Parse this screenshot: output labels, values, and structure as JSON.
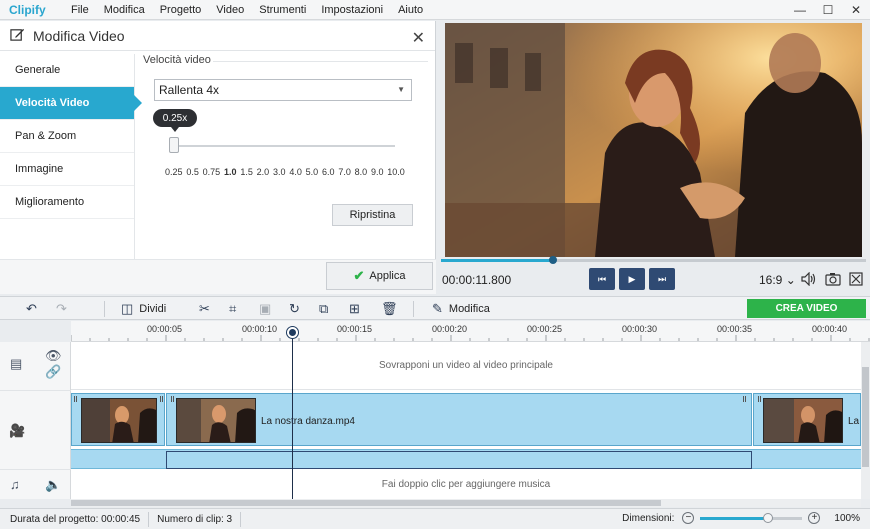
{
  "app": {
    "logo": "Clipify",
    "menu": [
      "File",
      "Modifica",
      "Progetto",
      "Video",
      "Strumenti",
      "Impostazioni",
      "Aiuto"
    ],
    "window_controls": {
      "minimize": "—",
      "maximize": "☐",
      "close": "✕"
    }
  },
  "edit_panel": {
    "title": "Modifica Video",
    "close": "✕",
    "tabs": [
      {
        "label": "Generale",
        "active": false
      },
      {
        "label": "Velocità Video",
        "active": true
      },
      {
        "label": "Pan & Zoom",
        "active": false
      },
      {
        "label": "Immagine",
        "active": false
      },
      {
        "label": "Miglioramento",
        "active": false
      }
    ],
    "speed": {
      "section_label": "Velocità video",
      "selected": "Rallenta 4x",
      "tooltip": "0.25x",
      "ticks": [
        "0.25",
        "0.5",
        "0.75",
        "1.0",
        "1.5",
        "2.0",
        "3.0",
        "4.0",
        "5.0",
        "6.0",
        "7.0",
        "8.0",
        "9.0",
        "10.0"
      ],
      "reset_label": "Ripristina"
    },
    "apply_label": "Applica"
  },
  "preview": {
    "timecode": "00:00:11.800",
    "progress_fraction": 0.26,
    "aspect_ratio": "16:9",
    "aspect_caret": "⌄"
  },
  "toolbar": {
    "split_label": "Dividi",
    "edit_label": "Modifica",
    "create_label": "CREA VIDEO"
  },
  "timeline": {
    "ruler_labels": [
      "00:00:05",
      "00:00:10",
      "00:00:15",
      "00:00:20",
      "00:00:25",
      "00:00:30",
      "00:00:35",
      "00:00:40"
    ],
    "overlay_hint": "Sovrapponi un video al video principale",
    "clip_name": "La nostra danza.mp4",
    "clip_name_partial": "La",
    "music_hint": "Fai doppio clic per aggiungere musica"
  },
  "statusbar": {
    "duration": "Durata del progetto: 00:00:45",
    "clip_count": "Numero di clip: 3",
    "dimensions_label": "Dimensioni:",
    "zoom_percent": "100%"
  },
  "colors": {
    "accent": "#28a8cf",
    "create_green": "#2db34a",
    "transport_blue": "#2f4a73",
    "clip_blue": "#a7d9f1"
  }
}
